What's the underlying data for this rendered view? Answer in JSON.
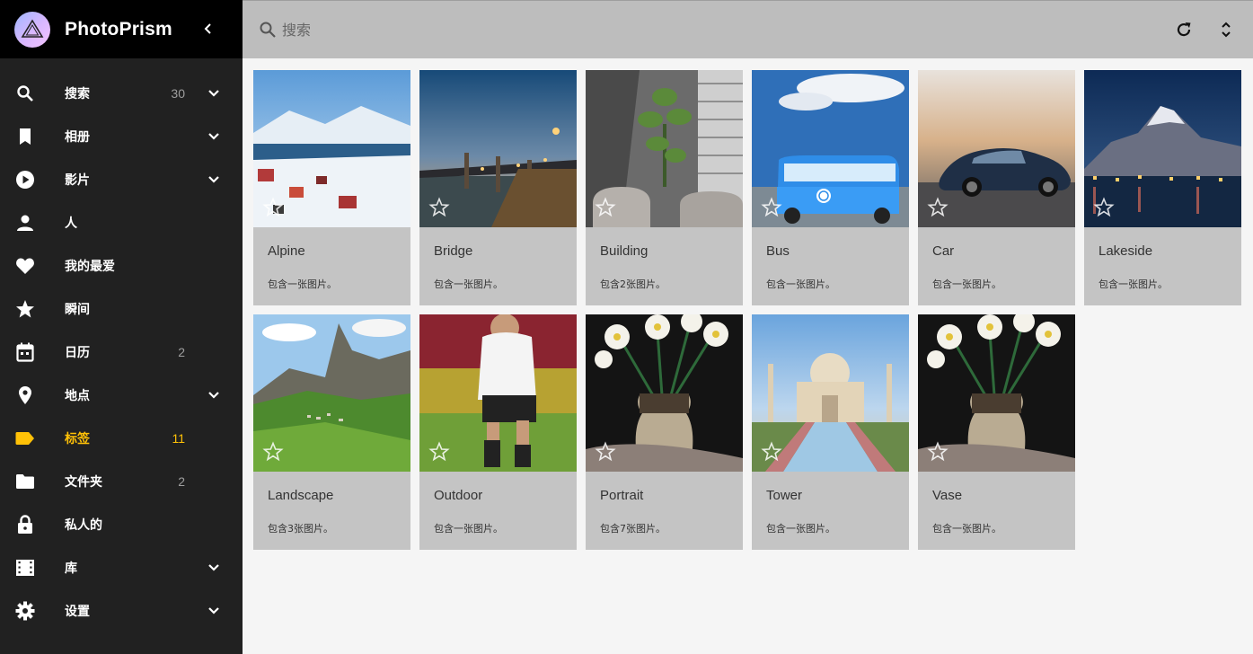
{
  "app": {
    "title": "PhotoPrism"
  },
  "search": {
    "placeholder": "搜索"
  },
  "sidebar": {
    "items": [
      {
        "label": "搜索",
        "count": "30"
      },
      {
        "label": "相册",
        "count": ""
      },
      {
        "label": "影片",
        "count": ""
      },
      {
        "label": "人",
        "count": ""
      },
      {
        "label": "我的最爱",
        "count": ""
      },
      {
        "label": "瞬间",
        "count": ""
      },
      {
        "label": "日历",
        "count": "2"
      },
      {
        "label": "地点",
        "count": ""
      },
      {
        "label": "标签",
        "count": "11"
      },
      {
        "label": "文件夹",
        "count": "2"
      },
      {
        "label": "私人的",
        "count": ""
      },
      {
        "label": "库",
        "count": ""
      },
      {
        "label": "设置",
        "count": ""
      }
    ]
  },
  "labels": [
    {
      "title": "Alpine",
      "subtitle": "包含一张图片。"
    },
    {
      "title": "Bridge",
      "subtitle": "包含一张图片。"
    },
    {
      "title": "Building",
      "subtitle": "包含2张图片。"
    },
    {
      "title": "Bus",
      "subtitle": "包含一张图片。"
    },
    {
      "title": "Car",
      "subtitle": "包含一张图片。"
    },
    {
      "title": "Lakeside",
      "subtitle": "包含一张图片。"
    },
    {
      "title": "Landscape",
      "subtitle": "包含3张图片。"
    },
    {
      "title": "Outdoor",
      "subtitle": "包含一张图片。"
    },
    {
      "title": "Portrait",
      "subtitle": "包含7张图片。"
    },
    {
      "title": "Tower",
      "subtitle": "包含一张图片。"
    },
    {
      "title": "Vase",
      "subtitle": "包含一张图片。"
    }
  ],
  "colors": {
    "accent": "#ffc107",
    "sidebar_bg": "#212121",
    "topbar_bg": "#bdbdbd",
    "card_bg": "#c4c4c4"
  }
}
